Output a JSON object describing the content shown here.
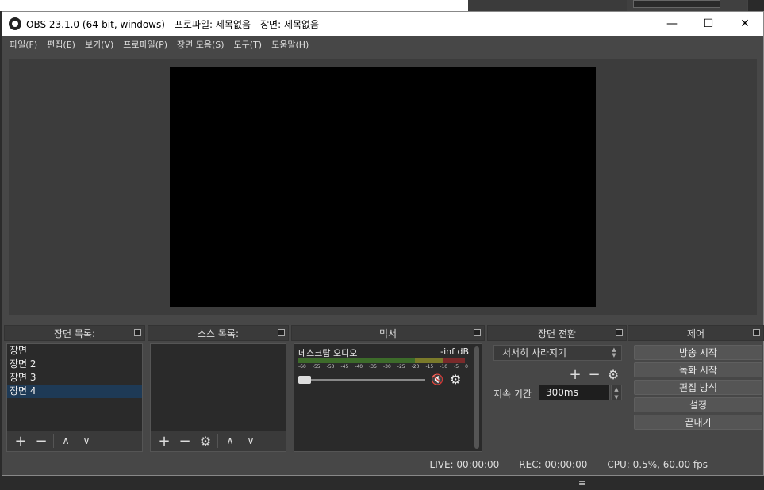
{
  "window": {
    "title": "OBS 23.1.0 (64-bit, windows) - 프로파일: 제목없음 - 장면: 제목없음",
    "minimize": "—",
    "maximize": "☐",
    "close": "✕"
  },
  "menu": [
    "파일(F)",
    "편집(E)",
    "보기(V)",
    "프로파일(P)",
    "장면 모음(S)",
    "도구(T)",
    "도움말(H)"
  ],
  "docks": {
    "scenes": {
      "title": "장면 목록:",
      "items": [
        "장면",
        "장면 2",
        "장면 3",
        "장면 4"
      ],
      "selected_index": 3
    },
    "sources": {
      "title": "소스 목록:"
    },
    "mixer": {
      "title": "믹서",
      "track_name": "데스크탑 오디오",
      "level": "-inf dB",
      "ticks": [
        "-60",
        "-55",
        "-50",
        "-45",
        "-40",
        "-35",
        "-30",
        "-25",
        "-20",
        "-15",
        "-10",
        "-5",
        "0"
      ],
      "muted": true
    },
    "transitions": {
      "title": "장면 전환",
      "selected": "서서히 사라지기",
      "duration_label": "지속 기간",
      "duration_value": "300ms"
    },
    "controls": {
      "title": "제어",
      "buttons": [
        "방송 시작",
        "녹화 시작",
        "편집 방식",
        "설정",
        "끝내기"
      ]
    }
  },
  "status": {
    "live": "LIVE: 00:00:00",
    "rec": "REC: 00:00:00",
    "cpu": "CPU: 0.5%, 60.00 fps"
  },
  "icons": {
    "add": "+",
    "remove": "−",
    "up": "∧",
    "down": "∨",
    "gear": "⚙",
    "mute": "🔇"
  },
  "colors": {
    "selected_row": "#1e3a56",
    "mute_red": "#e22233"
  }
}
